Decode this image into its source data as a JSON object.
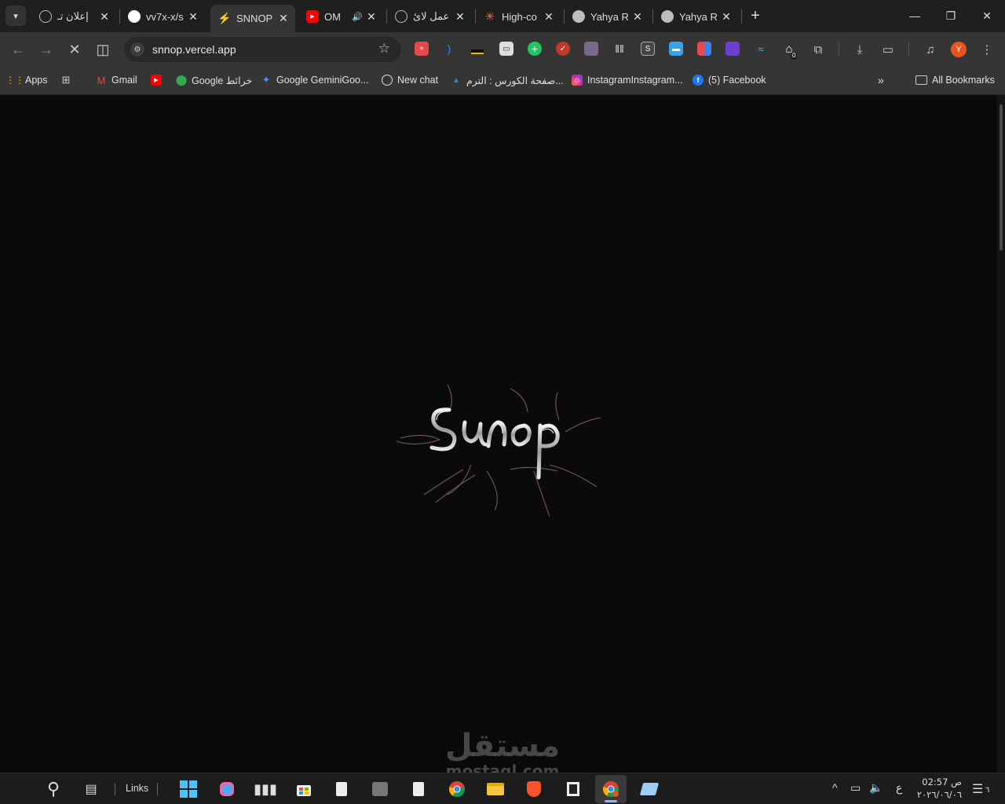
{
  "browser": {
    "tabs": [
      {
        "title": "إعلان تـ",
        "favicon": "chatgpt-icon",
        "color": "#bdbdbd"
      },
      {
        "title": "vv7x-x/s",
        "favicon": "github-icon",
        "color": "#ffffff"
      },
      {
        "title": "SNNOP",
        "favicon": "bolt-icon",
        "color": "#f6c34a"
      },
      {
        "title": "OM",
        "favicon": "youtube-icon",
        "color": "#ff0000"
      },
      {
        "title": "عمل لائ",
        "favicon": "chatgpt-icon",
        "color": "#bdbdbd"
      },
      {
        "title": "High-co",
        "favicon": "claude-icon",
        "color": "#d97757"
      },
      {
        "title": "Yahya R",
        "favicon": "globe-icon",
        "color": "#bdbdbd"
      },
      {
        "title": "Yahya R",
        "favicon": "globe-icon",
        "color": "#bdbdbd"
      }
    ],
    "active_tab_index": 2,
    "url": "snnop.vercel.app",
    "profile_initial": "Y",
    "extension_badge": "0",
    "bookmarks": [
      {
        "label": "Apps",
        "icon": "apps-grid-icon",
        "color": "#f4b400"
      },
      {
        "label": "",
        "icon": "tab-groups-icon",
        "color": "#cccccc"
      },
      {
        "label": "Gmail",
        "icon": "gmail-icon",
        "color": "#ea4335"
      },
      {
        "label": "",
        "icon": "youtube-icon",
        "color": "#ff0000"
      },
      {
        "label": "Google خرائط",
        "icon": "maps-icon",
        "color": "#34a853"
      },
      {
        "label": "Google GeminiGoo...",
        "icon": "gemini-icon",
        "color": "#4f8cff"
      },
      {
        "label": "New chat",
        "icon": "chatgpt-icon",
        "color": "#e0e0e0"
      },
      {
        "label": "صفحة الكورس : الترم...",
        "icon": "course-icon",
        "color": "#3b82c4"
      },
      {
        "label": "InstagramInstagram...",
        "icon": "instagram-icon",
        "color": "#d6249f"
      },
      {
        "label": "(5) Facebook",
        "icon": "facebook-icon",
        "color": "#1877f2"
      }
    ],
    "all_bookmarks_label": "All Bookmarks"
  },
  "page": {
    "logo_text": "SNNOP",
    "accent": "#b8b8b8"
  },
  "watermark": {
    "arabic": "مستقل",
    "latin": "mostaql.com"
  },
  "taskbar": {
    "links_label": "Links",
    "clock_time": "02:57 ص",
    "clock_date": "٢٠٢٦/٠٦/٠٦",
    "input_language": "ع",
    "notification_count": "٦"
  }
}
